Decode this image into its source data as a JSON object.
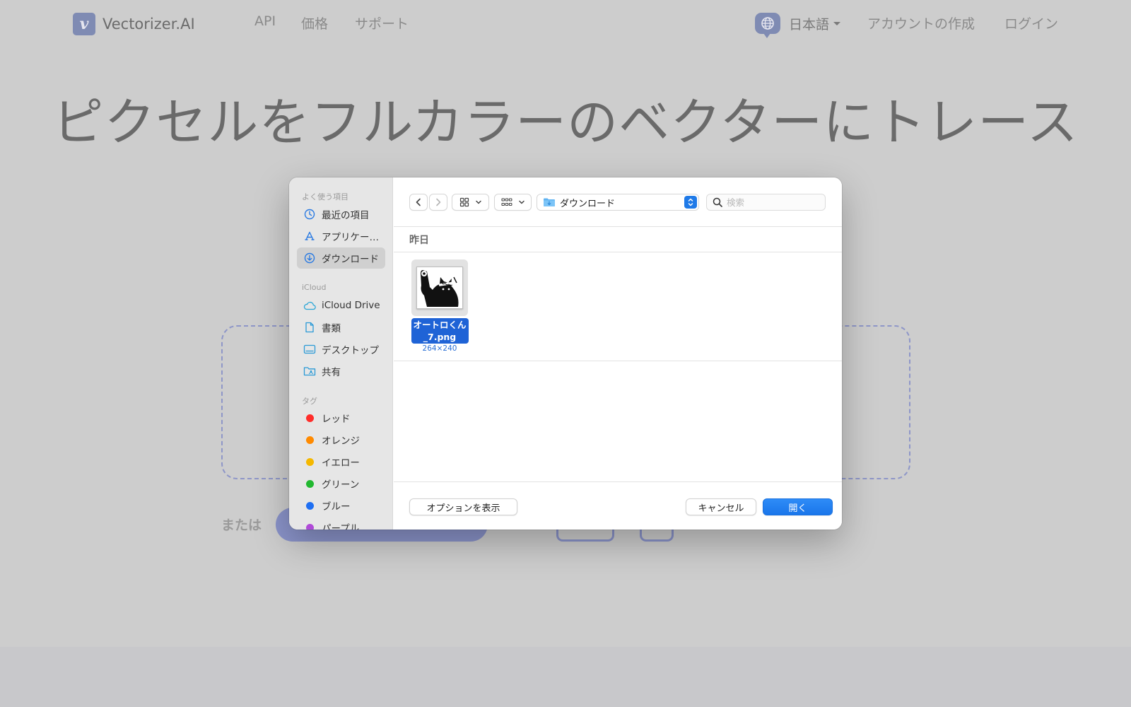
{
  "site": {
    "logo_letter": "v",
    "logo_text": "Vectorizer.AI",
    "nav": [
      "API",
      "価格",
      "サポート"
    ],
    "language": "日本語",
    "create_account": "アカウントの作成",
    "login": "ログイン",
    "hero_title": "ピクセルをフルカラーのベクターにトレース",
    "or_label": "または",
    "colors": {
      "accent": "#7f8bb3",
      "dropzone_border": "#8e96c8"
    }
  },
  "dialog": {
    "sidebar": {
      "favorites_heading": "よく使う項目",
      "favorites": [
        {
          "label": "最近の項目",
          "icon": "clock-icon"
        },
        {
          "label": "アプリケー…",
          "icon": "applications-icon"
        },
        {
          "label": "ダウンロード",
          "icon": "download-icon",
          "selected": true
        }
      ],
      "icloud_heading": "iCloud",
      "icloud": [
        {
          "label": "iCloud Drive",
          "icon": "cloud-icon"
        },
        {
          "label": "書類",
          "icon": "document-icon"
        },
        {
          "label": "デスクトップ",
          "icon": "desktop-icon"
        },
        {
          "label": "共有",
          "icon": "shared-folder-icon"
        }
      ],
      "tags_heading": "タグ",
      "tags": [
        {
          "label": "レッド",
          "color": "#ff2d2a"
        },
        {
          "label": "オレンジ",
          "color": "#ff8a00"
        },
        {
          "label": "イエロー",
          "color": "#f5b800"
        },
        {
          "label": "グリーン",
          "color": "#22b830"
        },
        {
          "label": "ブルー",
          "color": "#1f6ff2"
        },
        {
          "label": "パープル",
          "color": "#b04ad8"
        }
      ]
    },
    "toolbar": {
      "location": "ダウンロード",
      "search_placeholder": "検索"
    },
    "group_label": "昨日",
    "file": {
      "name": "オートロくん_7.png",
      "dimensions": "264×240"
    },
    "buttons": {
      "options": "オプションを表示",
      "cancel": "キャンセル",
      "open": "開く"
    },
    "colors": {
      "primary": "#1a76ea",
      "selection": "#1f63d6"
    }
  }
}
